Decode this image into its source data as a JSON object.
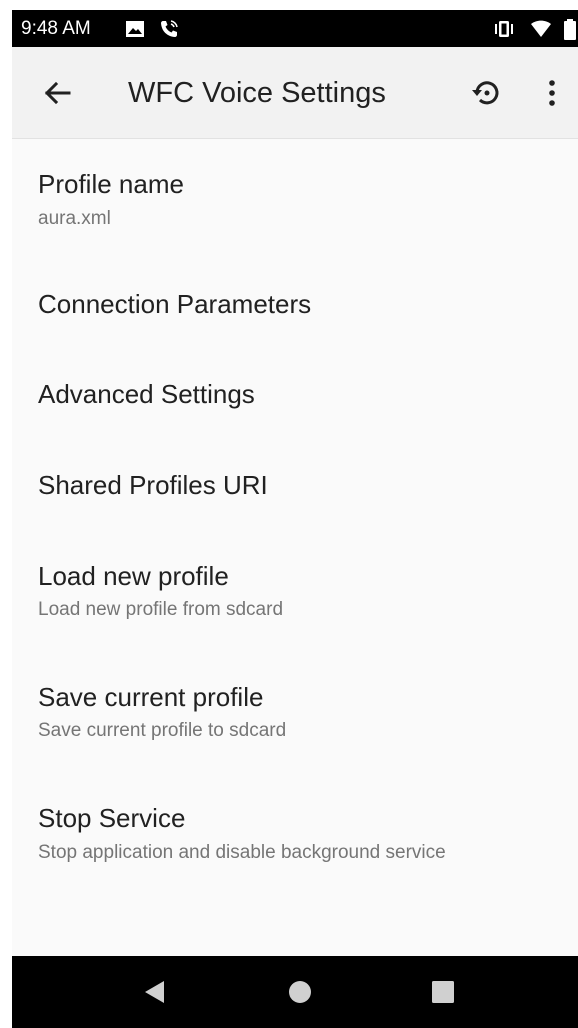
{
  "status_bar": {
    "time": "9:48 AM",
    "icons": [
      "image-icon",
      "call-icon",
      "vibrate-icon",
      "wifi-icon",
      "battery-icon"
    ]
  },
  "app_bar": {
    "title": "WFC Voice Settings",
    "back_icon": "arrow-back-icon",
    "restore_icon": "restore-icon",
    "more_icon": "more-vert-icon"
  },
  "preferences": [
    {
      "title": "Profile name",
      "summary": "aura.xml"
    },
    {
      "title": "Connection Parameters",
      "summary": ""
    },
    {
      "title": "Advanced Settings",
      "summary": ""
    },
    {
      "title": "Shared Profiles URI",
      "summary": ""
    },
    {
      "title": "Load new profile",
      "summary": "Load new profile from sdcard"
    },
    {
      "title": "Save current profile",
      "summary": "Save current profile to sdcard"
    },
    {
      "title": "Stop Service",
      "summary": "Stop application and disable background service"
    }
  ],
  "nav_bar": {
    "icons": [
      "back-triangle-icon",
      "home-circle-icon",
      "recents-square-icon"
    ]
  },
  "colors": {
    "status_bar": "#000000",
    "app_bar": "#f2f2f2",
    "background": "#fafafa",
    "title_text": "#212121",
    "summary_text": "#757575",
    "nav_bar": "#000000",
    "nav_icon": "#d0d0d0"
  }
}
